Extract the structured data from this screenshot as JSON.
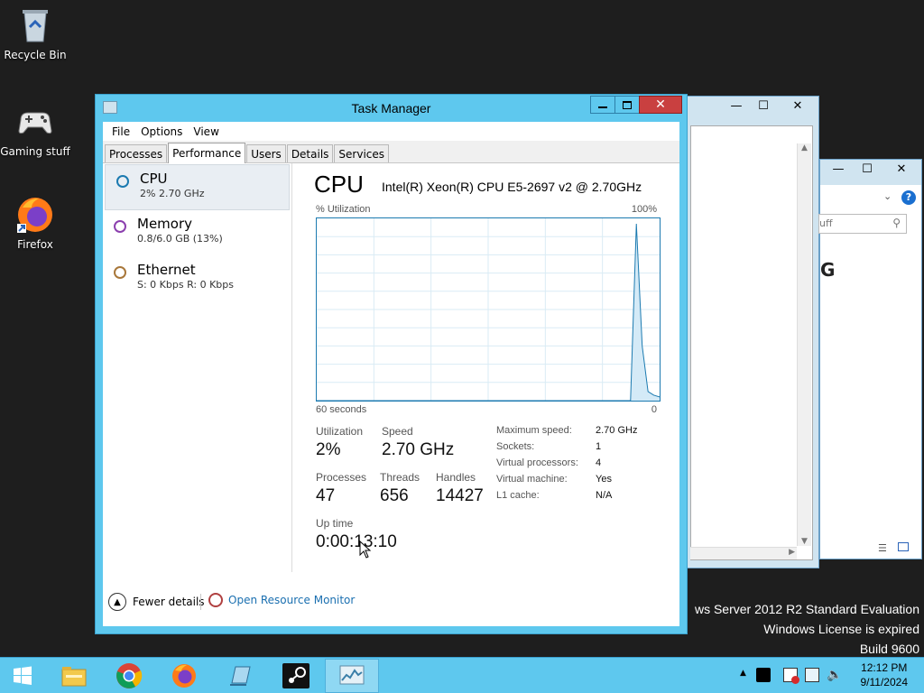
{
  "desktop": {
    "icons": [
      {
        "label": "Recycle Bin",
        "icon": "recycle-bin-icon"
      },
      {
        "label": "Gaming stuff",
        "icon": "gamepad-icon"
      },
      {
        "label": "Firefox",
        "icon": "firefox-icon"
      }
    ],
    "watermark": {
      "line1": "ws Server 2012 R2 Standard Evaluation",
      "line2": "Windows License is expired",
      "line3": "Build 9600"
    },
    "bg_window_search_placeholder": "uff"
  },
  "task_manager": {
    "title": "Task Manager",
    "menu": [
      "File",
      "Options",
      "View"
    ],
    "tabs": [
      "Processes",
      "Performance",
      "Users",
      "Details",
      "Services"
    ],
    "active_tab": "Performance",
    "resources": [
      {
        "name": "CPU",
        "detail": "2% 2.70 GHz",
        "color": "#1b7ab0"
      },
      {
        "name": "Memory",
        "detail": "0.8/6.0 GB (13%)",
        "color": "#8b3fae"
      },
      {
        "name": "Ethernet",
        "detail": "S: 0 Kbps R: 0 Kbps",
        "color": "#a8773a"
      }
    ],
    "cpu": {
      "heading": "CPU",
      "model": "Intel(R) Xeon(R) CPU E5-2697 v2 @ 2.70GHz",
      "graph_top_left": "% Utilization",
      "graph_top_right": "100%",
      "graph_bottom_left": "60 seconds",
      "graph_bottom_right": "0",
      "stats": {
        "utilization_label": "Utilization",
        "utilization": "2%",
        "speed_label": "Speed",
        "speed": "2.70 GHz",
        "processes_label": "Processes",
        "processes": "47",
        "threads_label": "Threads",
        "threads": "656",
        "handles_label": "Handles",
        "handles": "14427",
        "uptime_label": "Up time",
        "uptime": "0:00:13:10"
      },
      "specs": [
        {
          "k": "Maximum speed:",
          "v": "2.70 GHz"
        },
        {
          "k": "Sockets:",
          "v": "1"
        },
        {
          "k": "Virtual processors:",
          "v": "4"
        },
        {
          "k": "Virtual machine:",
          "v": "Yes"
        },
        {
          "k": "L1 cache:",
          "v": "N/A"
        }
      ],
      "utilization_history": [
        0,
        0,
        0,
        0,
        0,
        0,
        0,
        0,
        0,
        0,
        0,
        0,
        0,
        0,
        0,
        0,
        0,
        0,
        0,
        0,
        0,
        0,
        0,
        0,
        0,
        0,
        0,
        0,
        0,
        0,
        0,
        0,
        0,
        0,
        0,
        0,
        0,
        0,
        0,
        0,
        0,
        0,
        0,
        0,
        0,
        0,
        0,
        0,
        0,
        0,
        0,
        0,
        0,
        0,
        0,
        97,
        30,
        5,
        3,
        2
      ]
    },
    "footer": {
      "fewer_details": "Fewer details",
      "open_resource_monitor": "Open Resource Monitor"
    }
  },
  "taskbar": {
    "apps": [
      "start-icon",
      "file-explorer-icon",
      "chrome-icon",
      "firefox-icon",
      "notepad-icon",
      "steam-icon",
      "task-manager-icon"
    ],
    "clock_time": "12:12 PM",
    "clock_date": "9/11/2024"
  },
  "colors": {
    "accent": "#5ec8ee",
    "cpu_line": "#1b7ab0"
  }
}
